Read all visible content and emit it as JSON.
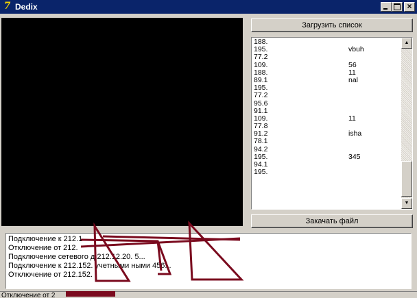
{
  "window": {
    "title": "Dedix",
    "icon": "app-logo-icon",
    "controls": [
      "minimize-icon",
      "maximize-icon",
      "close-icon"
    ]
  },
  "buttons": {
    "load_list": "Загрузить список",
    "download_file": "Закачать файл"
  },
  "server_list": [
    {
      "ip": "188.",
      "name": ""
    },
    {
      "ip": "195.",
      "name": "vbuh"
    },
    {
      "ip": "77.2",
      "name": ""
    },
    {
      "ip": "109.",
      "name": "56"
    },
    {
      "ip": "188.",
      "name": "11"
    },
    {
      "ip": "89.1",
      "name": "nal"
    },
    {
      "ip": "195.",
      "name": ""
    },
    {
      "ip": "77.2",
      "name": ""
    },
    {
      "ip": "95.6",
      "name": ""
    },
    {
      "ip": "91.1",
      "name": ""
    },
    {
      "ip": "109.",
      "name": "11"
    },
    {
      "ip": "77.8",
      "name": ""
    },
    {
      "ip": "91.2",
      "name": "isha"
    },
    {
      "ip": "78.1",
      "name": ""
    },
    {
      "ip": "94.2",
      "name": ""
    },
    {
      "ip": "195.",
      "name": "345"
    },
    {
      "ip": "94.1",
      "name": ""
    },
    {
      "ip": "195.",
      "name": ""
    }
  ],
  "log": [
    "Подключение к 212.1",
    "Отключение от 212.",
    "Подключение сетевого д      212.12.20.   5...",
    "Подключение к 212.152.        учетными      ными      456...",
    "Отключение от 212.152."
  ],
  "status": "Отключение от 2",
  "colors": {
    "titlebar": "#0a246a",
    "preview": "#000000",
    "scribble": "#7a0a1e"
  }
}
